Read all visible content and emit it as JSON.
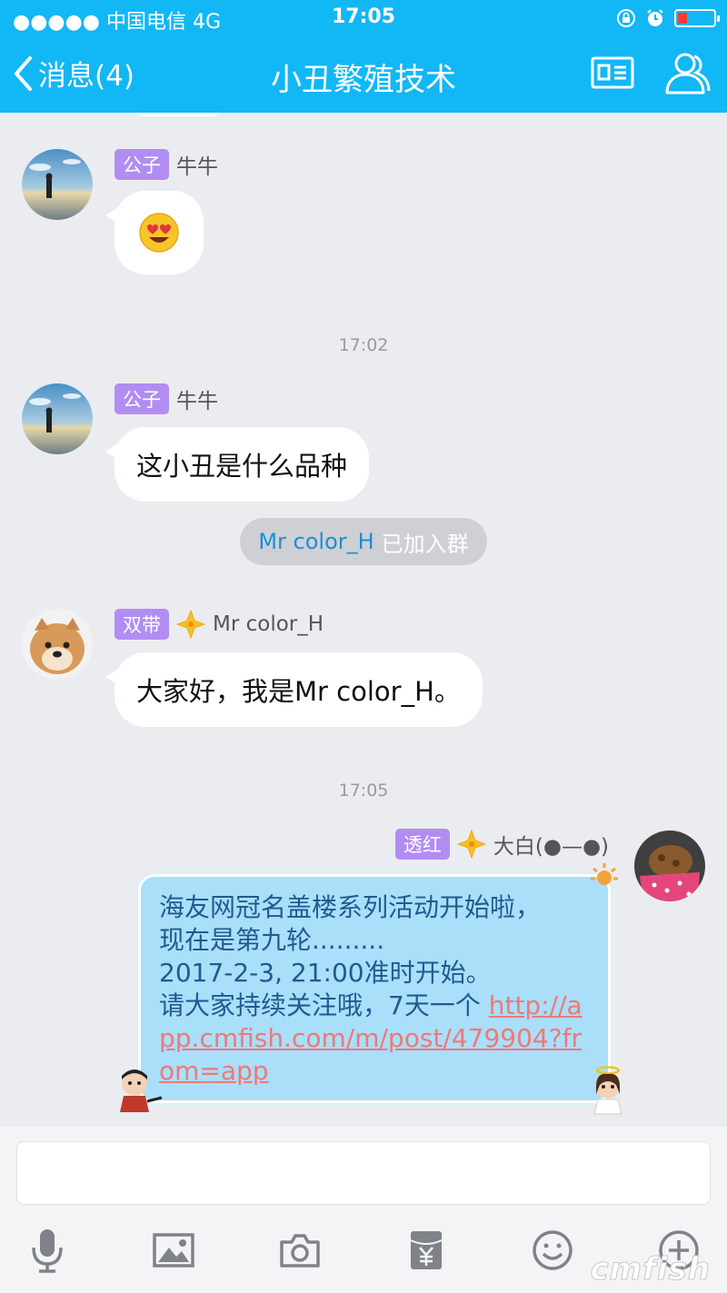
{
  "status_bar": {
    "carrier": "●●●●● 中国电信  4G",
    "time": "17:05"
  },
  "nav": {
    "back_label": "消息(4)",
    "title": "小丑繁殖技术"
  },
  "messages": [
    {
      "badge": "公子",
      "sender": "牛牛",
      "type": "emoji",
      "content": "heart-eyes-emoji"
    },
    {
      "timestamp": "17:02"
    },
    {
      "badge": "公子",
      "sender": "牛牛",
      "type": "text",
      "content": "这小丑是什么品种"
    },
    {
      "system": {
        "name": "Mr color_H",
        "text": "已加入群"
      }
    },
    {
      "badge": "双带",
      "sender": "Mr color_H",
      "type": "text",
      "content": "大家好，我是Mr color_H。"
    },
    {
      "timestamp": "17:05"
    },
    {
      "badge": "透红",
      "sender": "大白(●—●)",
      "type": "text",
      "lines": [
        "海友网冠名盖楼系列活动开始啦，",
        "现在是第九轮.........",
        "2017-2-3, 21:00准时开始。",
        "请大家持续关注哦，7天一个 "
      ],
      "url": "http://app.cmfish.com/m/post/479904?from=app"
    }
  ],
  "input": {
    "placeholder": ""
  },
  "toolbar": [
    "mic-icon",
    "image-icon",
    "camera-icon",
    "red-packet-icon",
    "emoji-icon",
    "plus-icon"
  ],
  "watermark": "cmfish",
  "colors": {
    "header": "#12b7f5",
    "badge": "#b18df2",
    "background": "#ebecf0",
    "my_bubble": "#a9dff8"
  }
}
